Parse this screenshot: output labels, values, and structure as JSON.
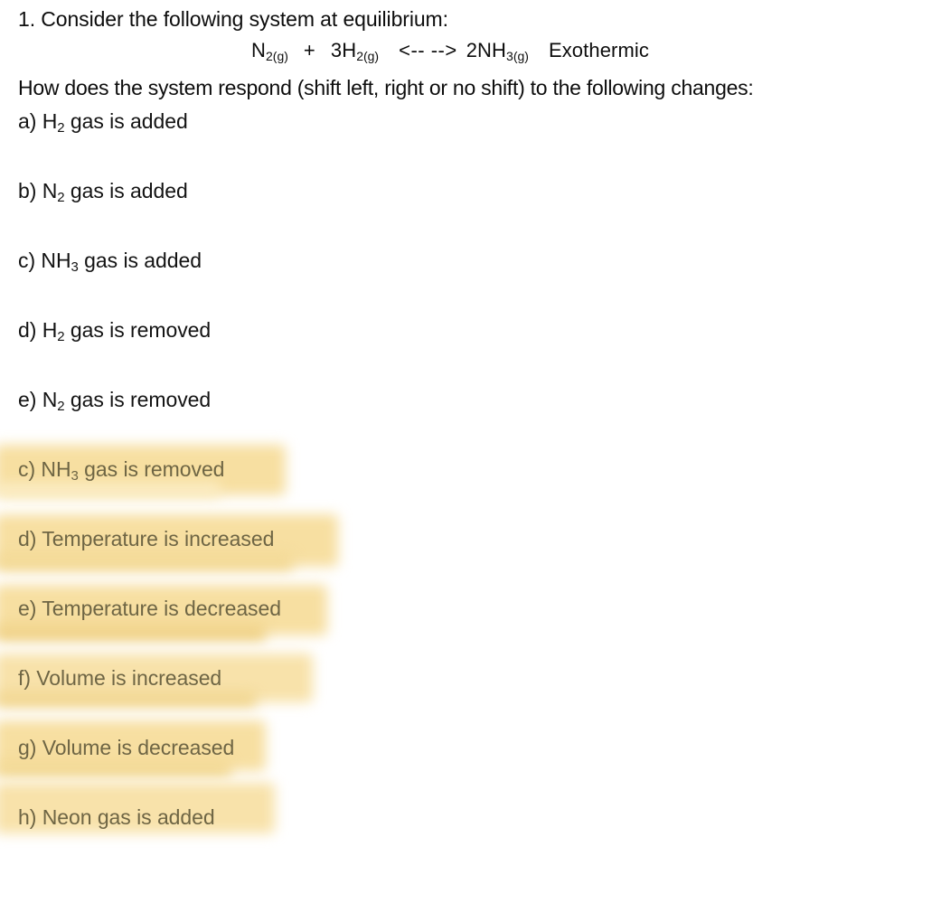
{
  "document": {
    "question_number": "1.",
    "title": "1. Consider the following system at equilibrium:",
    "prompt": "How does the system respond (shift left, right or no shift) to the following changes:",
    "equation": {
      "reactant1": "N",
      "reactant1_sub": "2(g)",
      "plus": "+",
      "reactant2": "3H",
      "reactant2_sub": "2(g)",
      "arrow": "<-- -->",
      "product": "2NH",
      "product_sub": "3(g)",
      "thermo": "Exothermic",
      "full_text": "N2(g) + 3H2(g) <-- --> 2NH3(g) Exothermic"
    },
    "options": [
      {
        "id": "a",
        "label": "a) H",
        "sub": "2",
        "rest": " gas is added",
        "highlighted": false
      },
      {
        "id": "b",
        "label": "b) N",
        "sub": "2",
        "rest": " gas is added",
        "highlighted": false
      },
      {
        "id": "c1",
        "label": "c) NH",
        "sub": "3",
        "rest": " gas is added",
        "highlighted": false
      },
      {
        "id": "d1",
        "label": "d) H",
        "sub": "2",
        "rest": " gas is removed",
        "highlighted": false
      },
      {
        "id": "e1",
        "label": "e) N",
        "sub": "2",
        "rest": " gas is removed",
        "highlighted": false
      },
      {
        "id": "c2",
        "label": "c) NH",
        "sub": "3",
        "rest": " gas is removed",
        "highlighted": true
      },
      {
        "id": "d2",
        "label": "d) Temperature is increased",
        "sub": "",
        "rest": "",
        "highlighted": true
      },
      {
        "id": "e2",
        "label": "e) Temperature is decreased",
        "sub": "",
        "rest": "",
        "highlighted": true
      },
      {
        "id": "f",
        "label": "f) Volume is increased",
        "sub": "",
        "rest": "",
        "highlighted": true
      },
      {
        "id": "g",
        "label": "g) Volume is decreased",
        "sub": "",
        "rest": "",
        "highlighted": true
      },
      {
        "id": "h",
        "label": "h) Neon gas is added",
        "sub": "",
        "rest": "",
        "highlighted": true
      }
    ]
  },
  "colors": {
    "page_background": "#ffffff",
    "body_text": "#131313",
    "highlighted_text": "#6e6544",
    "highlight_marker": "#f7dfa1",
    "highlight_marker_light": "#fbecc2"
  }
}
